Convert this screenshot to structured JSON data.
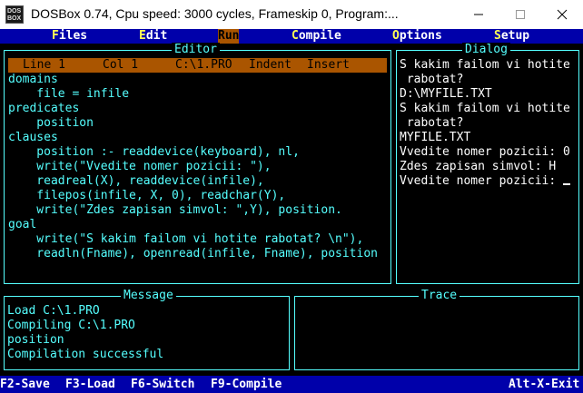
{
  "window": {
    "icon_text_1": "DOS",
    "icon_text_2": "BOX",
    "title": "DOSBox 0.74, Cpu speed:     3000 cycles, Frameskip  0, Program:..."
  },
  "menu": [
    {
      "label": "Files",
      "hot": "F",
      "rest": "iles",
      "active": false
    },
    {
      "label": "Edit",
      "hot": "E",
      "rest": "dit",
      "active": false
    },
    {
      "label": "Run",
      "hot": "R",
      "rest": "un",
      "active": true
    },
    {
      "label": "Compile",
      "hot": "C",
      "rest": "ompile",
      "active": false
    },
    {
      "label": "Options",
      "hot": "O",
      "rest": "ptions",
      "active": false
    },
    {
      "label": "Setup",
      "hot": "S",
      "rest": "etup",
      "active": false
    }
  ],
  "editor": {
    "title": "Editor",
    "status": {
      "line": "Line 1",
      "col": "Col 1",
      "file": "C:\\1.PRO",
      "indent": "Indent",
      "insert": "Insert"
    },
    "lines": [
      "domains",
      "    file = infile",
      "predicates",
      "    position",
      "clauses",
      "    position :- readdevice(keyboard), nl,",
      "    write(\"Vvedite nomer pozicii: \"),",
      "    readreal(X), readdevice(infile),",
      "    filepos(infile, X, 0), readchar(Y),",
      "    write(\"Zdes zapisan simvol: \",Y), position.",
      "goal",
      "    write(\"S kakim failom vi hotite rabotat? \\n\"),",
      "    readln(Fname), openread(infile, Fname), position"
    ]
  },
  "dialog": {
    "title": "Dialog",
    "lines": [
      "S kakim failom vi hotite",
      " rabotat?",
      "D:\\MYFILE.TXT",
      "S kakim failom vi hotite",
      " rabotat?",
      "MYFILE.TXT",
      "",
      "Vvedite nomer pozicii: 0",
      "",
      "Zdes zapisan simvol: H",
      "Vvedite nomer pozicii: "
    ]
  },
  "message": {
    "title": "Message",
    "lines": [
      "Load C:\\1.PRO",
      "Compiling C:\\1.PRO",
      "position",
      "Compilation successful"
    ]
  },
  "trace": {
    "title": "Trace"
  },
  "fkeys": [
    {
      "label": "F2-Save"
    },
    {
      "label": "F3-Load"
    },
    {
      "label": "F6-Switch"
    },
    {
      "label": "F9-Compile"
    },
    {
      "label": "Alt-X-Exit"
    }
  ],
  "colors": {
    "dos_blue": "#0000aa",
    "dos_cyan": "#55ffff",
    "dos_orange": "#aa5500",
    "dos_yellow": "#ffff55"
  }
}
